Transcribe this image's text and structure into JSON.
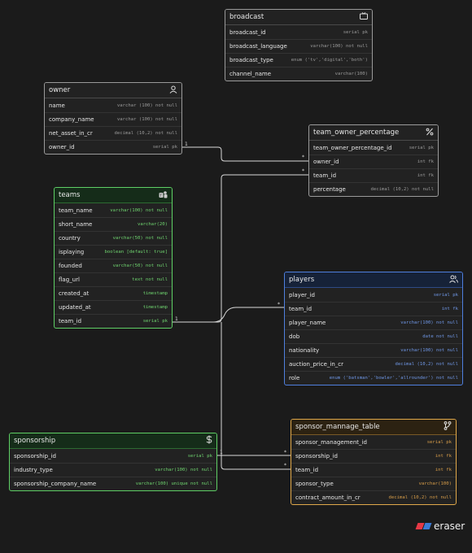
{
  "entities": {
    "broadcast": {
      "title": "broadcast",
      "icon": "tv-icon",
      "fields": [
        {
          "name": "broadcast_id",
          "type": "serial pk"
        },
        {
          "name": "broadcast_language",
          "type": "varchar(100) not null"
        },
        {
          "name": "broadcast_type",
          "type": "enum ('tv','digital','both')"
        },
        {
          "name": "channel_name",
          "type": "varchar(100)"
        }
      ]
    },
    "owner": {
      "title": "owner",
      "icon": "user-icon",
      "fields": [
        {
          "name": "name",
          "type": "varchar (100) not null"
        },
        {
          "name": "company_name",
          "type": "varchar (100) not null"
        },
        {
          "name": "net_asset_in_cr",
          "type": "decimal (10,2) not null"
        },
        {
          "name": "owner_id",
          "type": "serial pk"
        }
      ]
    },
    "team_owner_percentage": {
      "title": "team_owner_percentage",
      "icon": "percent-icon",
      "fields": [
        {
          "name": "team_owner_percentage_id",
          "type": "serial pk"
        },
        {
          "name": "owner_id",
          "type": "int fk"
        },
        {
          "name": "team_id",
          "type": "int fk"
        },
        {
          "name": "percentage",
          "type": "decimal (10,2) not null"
        }
      ]
    },
    "teams": {
      "title": "teams",
      "icon": "teams-icon",
      "fields": [
        {
          "name": "team_name",
          "type": "varchar(100) not null"
        },
        {
          "name": "short_name",
          "type": "varchar(20)"
        },
        {
          "name": "country",
          "type": "varchar(50) not null"
        },
        {
          "name": "isplaying",
          "type": "boolean [default: true]"
        },
        {
          "name": "founded",
          "type": "varchar(50) not null"
        },
        {
          "name": "flag_url",
          "type": "text not null"
        },
        {
          "name": "created_at",
          "type": "timestamp"
        },
        {
          "name": "updated_at",
          "type": "timestamp"
        },
        {
          "name": "team_id",
          "type": "serial pk"
        }
      ]
    },
    "players": {
      "title": "players",
      "icon": "users-icon",
      "fields": [
        {
          "name": "player_id",
          "type": "serial pk"
        },
        {
          "name": "team_id",
          "type": "int fk"
        },
        {
          "name": "player_name",
          "type": "varchar(100) not null"
        },
        {
          "name": "dob",
          "type": "date not null"
        },
        {
          "name": "nationality",
          "type": "varchar(100) not null"
        },
        {
          "name": "auction_price_in_cr",
          "type": "decimal (10,2) not null"
        },
        {
          "name": "role",
          "type": "enum ('batsman','bowler','allrounder') not null"
        }
      ]
    },
    "sponsorship": {
      "title": "sponsorship",
      "icon": "dollar-icon",
      "fields": [
        {
          "name": "sponsorship_id",
          "type": "serial pk"
        },
        {
          "name": "industry_type",
          "type": "varchar(100) not null"
        },
        {
          "name": "sponsorship_company_name",
          "type": "varchar(100) unique not null"
        }
      ]
    },
    "sponsor_mannage_table": {
      "title": "sponsor_mannage_table",
      "icon": "branch-icon",
      "fields": [
        {
          "name": "sponsor_management_id",
          "type": "serial pk"
        },
        {
          "name": "sponsorship_id",
          "type": "int fk"
        },
        {
          "name": "team_id",
          "type": "int fk"
        },
        {
          "name": "sponsor_type",
          "type": "varchar(100)"
        },
        {
          "name": "contract_amount_in_cr",
          "type": "decimal (10,2) not null"
        }
      ]
    }
  },
  "relations": [
    {
      "from": "owner.owner_id",
      "to": "team_owner_percentage.owner_id",
      "from_card": "1",
      "to_card": "*"
    },
    {
      "from": "teams.team_id",
      "to": "team_owner_percentage.team_id",
      "from_card": "1",
      "to_card": "*"
    },
    {
      "from": "teams.team_id",
      "to": "players.team_id",
      "from_card": "1",
      "to_card": "*"
    },
    {
      "from": "teams.team_id",
      "to": "sponsor_mannage_table.team_id",
      "from_card": "1",
      "to_card": "*"
    },
    {
      "from": "sponsorship.sponsorship_id",
      "to": "sponsor_mannage_table.sponsorship_id",
      "from_card": "1",
      "to_card": "*"
    }
  ],
  "logo": {
    "text": "eraser",
    "colors": [
      "#e63946",
      "#3a7bd5"
    ]
  },
  "theme": {
    "green": "#5fcf65",
    "blue": "#4f7fde",
    "orange": "#e0a84a",
    "neutral": "#9a9a9a",
    "background": "#1b1b1b"
  }
}
